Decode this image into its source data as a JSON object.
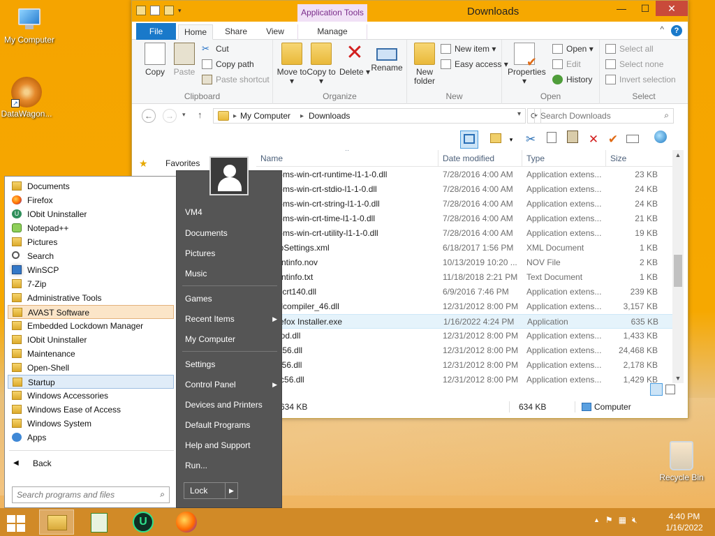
{
  "desktop": {
    "icons": [
      {
        "label": "My Computer"
      },
      {
        "label": "DataWagon..."
      },
      {
        "label": "Recycle Bin"
      }
    ]
  },
  "explorer": {
    "title": "Downloads",
    "contextual_tab": "Application Tools",
    "tabs": {
      "file": "File",
      "home": "Home",
      "share": "Share",
      "view": "View",
      "manage": "Manage"
    },
    "ribbon": {
      "clipboard": {
        "group": "Clipboard",
        "copy": "Copy",
        "paste": "Paste",
        "cut": "Cut",
        "copy_path": "Copy path",
        "paste_shortcut": "Paste shortcut"
      },
      "organize": {
        "group": "Organize",
        "move_to": "Move to ▾",
        "copy_to": "Copy to ▾",
        "delete": "Delete ▾",
        "rename": "Rename"
      },
      "new": {
        "group": "New",
        "new_folder": "New folder",
        "new_item": "New item ▾",
        "easy_access": "Easy access ▾"
      },
      "open": {
        "group": "Open",
        "properties": "Properties ▾",
        "open": "Open ▾",
        "edit": "Edit",
        "history": "History"
      },
      "select": {
        "group": "Select",
        "select_all": "Select all",
        "select_none": "Select none",
        "invert_selection": "Invert selection"
      }
    },
    "address": {
      "crumb1": "My Computer",
      "crumb2": "Downloads"
    },
    "search_placeholder": "Search Downloads",
    "nav": {
      "favorites": "Favorites"
    },
    "columns": {
      "name": "Name",
      "date": "Date modified",
      "type": "Type",
      "size": "Size"
    },
    "files": [
      {
        "name": "api-ms-win-crt-runtime-l1-1-0.dll",
        "date": "7/28/2016 4:00 AM",
        "type": "Application extens...",
        "size": "23 KB"
      },
      {
        "name": "api-ms-win-crt-stdio-l1-1-0.dll",
        "date": "7/28/2016 4:00 AM",
        "type": "Application extens...",
        "size": "24 KB"
      },
      {
        "name": "api-ms-win-crt-string-l1-1-0.dll",
        "date": "7/28/2016 4:00 AM",
        "type": "Application extens...",
        "size": "24 KB"
      },
      {
        "name": "api-ms-win-crt-time-l1-1-0.dll",
        "date": "7/28/2016 4:00 AM",
        "type": "Application extens...",
        "size": "21 KB"
      },
      {
        "name": "api-ms-win-crt-utility-l1-1-0.dll",
        "date": "7/28/2016 4:00 AM",
        "type": "Application extens...",
        "size": "19 KB"
      },
      {
        "name": "AppSettings.xml",
        "date": "6/18/2017 1:56 PM",
        "type": "XML Document",
        "size": "1 KB"
      },
      {
        "name": "clientinfo.nov",
        "date": "10/13/2019 10:20 ...",
        "type": "NOV File",
        "size": "2 KB"
      },
      {
        "name": "clientinfo.txt",
        "date": "11/18/2018 2:21 PM",
        "type": "Text Document",
        "size": "1 KB"
      },
      {
        "name": "concrt140.dll",
        "date": "6/9/2016 7:46 PM",
        "type": "Application extens...",
        "size": "239 KB"
      },
      {
        "name": "d3dcompiler_46.dll",
        "date": "12/31/2012 8:00 PM",
        "type": "Application extens...",
        "size": "3,157 KB"
      },
      {
        "name": "Firefox Installer.exe",
        "date": "1/16/2022 4:24 PM",
        "type": "Application",
        "size": "635 KB"
      },
      {
        "name": "hmod.dll",
        "date": "12/31/2012 8:00 PM",
        "type": "Application extens...",
        "size": "1,433 KB"
      },
      {
        "name": "iudt56.dll",
        "date": "12/31/2012 8:00 PM",
        "type": "Application extens...",
        "size": "24,468 KB"
      },
      {
        "name": "iuin56.dll",
        "date": "12/31/2012 8:00 PM",
        "type": "Application extens...",
        "size": "2,178 KB"
      },
      {
        "name": "iuuc56.dll",
        "date": "12/31/2012 8:00 PM",
        "type": "Application extens...",
        "size": "1,429 KB"
      }
    ],
    "status": {
      "selected_size": "634 KB",
      "size2": "634 KB",
      "location": "Computer"
    }
  },
  "start_menu": {
    "programs": [
      {
        "label": "Documents",
        "icon": "folder-icon"
      },
      {
        "label": "Firefox",
        "icon": "firefox-icon"
      },
      {
        "label": "IObit Uninstaller",
        "icon": "iobit-icon"
      },
      {
        "label": "Notepad++",
        "icon": "notepadpp-icon"
      },
      {
        "label": "Pictures",
        "icon": "folder-icon"
      },
      {
        "label": "Search",
        "icon": "search-icon"
      },
      {
        "label": "WinSCP",
        "icon": "winscp-icon"
      },
      {
        "label": "7-Zip",
        "icon": "folder-icon"
      },
      {
        "label": "Administrative Tools",
        "icon": "folder-icon"
      },
      {
        "label": "AVAST Software",
        "icon": "folder-icon"
      },
      {
        "label": "Embedded Lockdown Manager",
        "icon": "folder-icon"
      },
      {
        "label": "IObit Uninstaller",
        "icon": "folder-icon"
      },
      {
        "label": "Maintenance",
        "icon": "folder-icon"
      },
      {
        "label": "Open-Shell",
        "icon": "folder-icon"
      },
      {
        "label": "Startup",
        "icon": "folder-icon"
      },
      {
        "label": "Windows Accessories",
        "icon": "folder-icon"
      },
      {
        "label": "Windows Ease of Access",
        "icon": "folder-icon"
      },
      {
        "label": "Windows System",
        "icon": "folder-icon"
      },
      {
        "label": "Apps",
        "icon": "apps-icon"
      }
    ],
    "back": "Back",
    "search_placeholder": "Search programs and files",
    "right": {
      "user": "VM4",
      "documents": "Documents",
      "pictures": "Pictures",
      "music": "Music",
      "games": "Games",
      "recent_items": "Recent Items",
      "my_computer": "My Computer",
      "settings": "Settings",
      "control_panel": "Control Panel",
      "devices_printers": "Devices and Printers",
      "default_programs": "Default Programs",
      "help_support": "Help and Support",
      "run": "Run...",
      "lock": "Lock"
    }
  },
  "taskbar": {
    "time": "4:40 PM",
    "date": "1/16/2022"
  }
}
